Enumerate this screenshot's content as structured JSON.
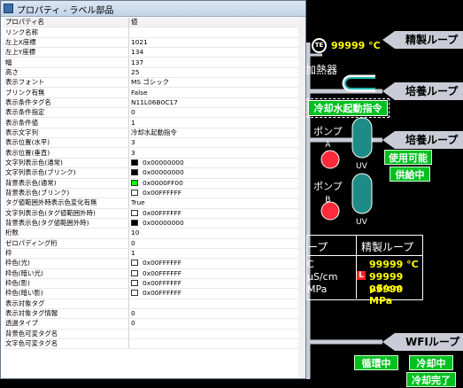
{
  "window": {
    "title": "プロパティ - ラベル部品"
  },
  "grid": {
    "header": {
      "name": "プロパティ名",
      "value": "値"
    },
    "rows": [
      {
        "name": "リンク名称",
        "value": ""
      },
      {
        "name": "左上X座標",
        "value": "1021"
      },
      {
        "name": "左上Y座標",
        "value": "134"
      },
      {
        "name": "幅",
        "value": "137"
      },
      {
        "name": "高さ",
        "value": "25"
      },
      {
        "name": "表示フォント",
        "value": "MS ゴシック"
      },
      {
        "name": "ブリンク有無",
        "value": "False"
      },
      {
        "name": "表示条件タグ名",
        "value": "N11L06B0C17"
      },
      {
        "name": "表示条件指定",
        "value": "0"
      },
      {
        "name": "表示条件値",
        "value": "1"
      },
      {
        "name": "表示文字列",
        "value": "冷却水起動指令"
      },
      {
        "name": "表示位置(水平)",
        "value": "3"
      },
      {
        "name": "表示位置(垂直)",
        "value": "3"
      },
      {
        "name": "文字列表示色(通常)",
        "value": "0x00000000",
        "swatch": "#000000"
      },
      {
        "name": "文字列表示色(ブリンク)",
        "value": "0x00000000",
        "swatch": "#000000"
      },
      {
        "name": "背景表示色(通常)",
        "value": "0x0000FF00",
        "swatch": "#00ff00"
      },
      {
        "name": "背景表示色(ブリンク)",
        "value": "0x00FFFFFF",
        "swatch": "#ffffff"
      },
      {
        "name": "タグ値範囲外時表示色変化有無",
        "value": "True"
      },
      {
        "name": "文字列表示色(タグ値範囲外時)",
        "value": "0x00FFFFFF",
        "swatch": "#ffffff"
      },
      {
        "name": "背景表示色(タグ値範囲外時)",
        "value": "0x00000000",
        "swatch": "#000000"
      },
      {
        "name": "桁数",
        "value": "10"
      },
      {
        "name": "ゼロパディング桁",
        "value": "0"
      },
      {
        "name": "枠",
        "value": "1"
      },
      {
        "name": "枠色(光)",
        "value": "0x00FFFFFF",
        "swatch": "#ffffff"
      },
      {
        "name": "枠色(暗い光)",
        "value": "0x00FFFFFF",
        "swatch": "#ffffff"
      },
      {
        "name": "枠色(影)",
        "value": "0x00FFFFFF",
        "swatch": "#ffffff"
      },
      {
        "name": "枠色(暗い影)",
        "value": "0x00FFFFFF",
        "swatch": "#ffffff"
      },
      {
        "name": "表示対象タグ",
        "value": ""
      },
      {
        "name": "表示対象タグ情報",
        "value": "0"
      },
      {
        "name": "透過タイプ",
        "value": "0"
      },
      {
        "name": "背景色可変タグ名",
        "value": ""
      },
      {
        "name": "文字色可変タグ名",
        "value": ""
      }
    ]
  },
  "scada": {
    "banner_refine": "精製ループ",
    "banner_culture1": "培養ループ",
    "banner_culture2": "培養ループ",
    "banner_wfi": "WFIループ",
    "te_label": "TE",
    "te_value": "99999 °C",
    "heater_label": "加熱器",
    "cooling_cmd": "冷却水起動指令",
    "pump_a": "ポンプ",
    "pump_a_letter": "A",
    "pump_b": "ポンプ",
    "pump_b_letter": "B",
    "uv_a": "UV",
    "uv_b": "UV",
    "status_usable": "使用可能",
    "status_supplying": "供給中",
    "table_left_header": "ープ",
    "table_right_header": "精製ループ",
    "left_units": [
      "C",
      "μS/cm",
      "MPa"
    ],
    "right_values": [
      "99999 °C",
      "99999 μS/cm",
      "99999 MPa"
    ],
    "alarm_mark": "L",
    "btn_circulating": "循環中",
    "btn_cooling": "冷却中",
    "btn_cooling_done": "冷却完了"
  }
}
